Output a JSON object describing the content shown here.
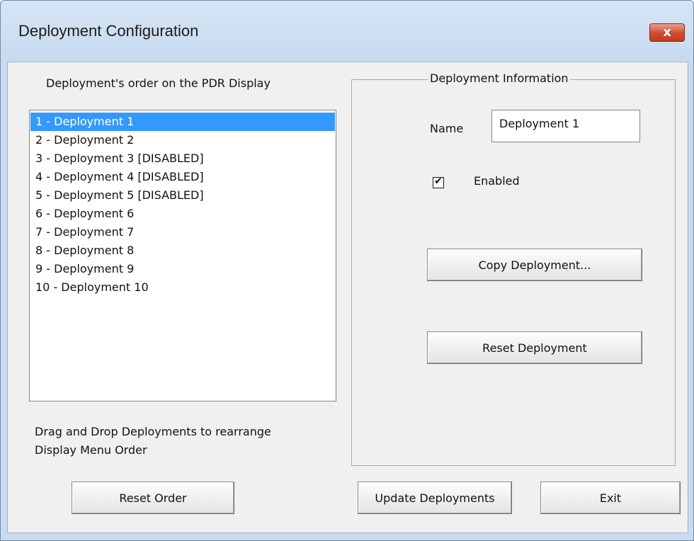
{
  "window": {
    "title": "Deployment Configuration",
    "close_label": "x"
  },
  "left": {
    "list_heading": "Deployment's order on the PDR Display",
    "items": [
      {
        "label": "1 - Deployment 1",
        "selected": true
      },
      {
        "label": "2 - Deployment 2",
        "selected": false
      },
      {
        "label": "3 - Deployment 3 [DISABLED]",
        "selected": false
      },
      {
        "label": "4 - Deployment 4 [DISABLED]",
        "selected": false
      },
      {
        "label": "5 - Deployment 5 [DISABLED]",
        "selected": false
      },
      {
        "label": "6 - Deployment 6",
        "selected": false
      },
      {
        "label": "7 - Deployment 7",
        "selected": false
      },
      {
        "label": "8 - Deployment 8",
        "selected": false
      },
      {
        "label": "9 - Deployment 9",
        "selected": false
      },
      {
        "label": "10 - Deployment 10",
        "selected": false
      }
    ],
    "hint_line1": "Drag and Drop Deployments to rearrange",
    "hint_line2": "Display Menu Order"
  },
  "info": {
    "group_title": "Deployment Information",
    "name_label": "Name",
    "name_value": "Deployment 1",
    "enabled_label": "Enabled",
    "enabled_checked": true,
    "check_glyph": "✔",
    "copy_button": "Copy Deployment...",
    "reset_button": "Reset Deployment"
  },
  "footer": {
    "reset_order_button": "Reset Order",
    "update_button": "Update Deployments",
    "exit_button": "Exit"
  },
  "colors": {
    "selection": "#3399ff",
    "close_button": "#c9462c",
    "frame": "#c9dbee"
  }
}
